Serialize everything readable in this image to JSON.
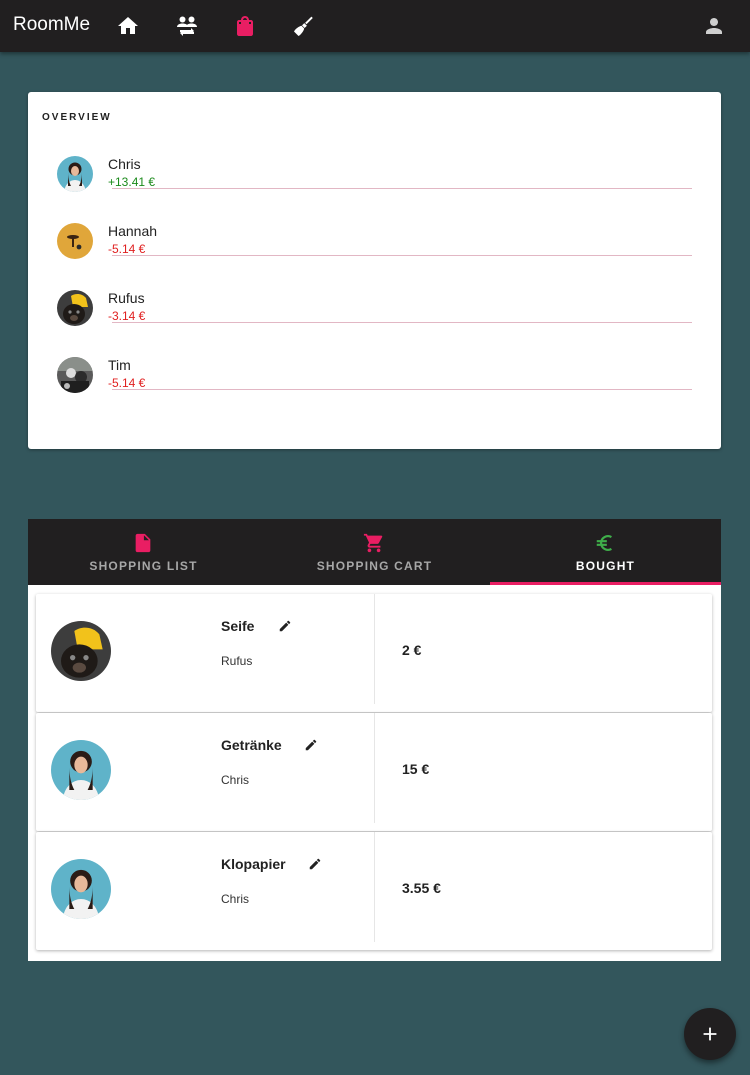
{
  "app": {
    "title": "RoomMe"
  },
  "colors": {
    "accent": "#e91e63",
    "positive": "#1b8a1b",
    "negative": "#e02020",
    "euro_green": "#3fae4a",
    "dark": "#211f20",
    "background": "#33565c"
  },
  "nav": {
    "items": [
      {
        "icon": "home-icon",
        "active": false
      },
      {
        "icon": "people-swap-icon",
        "active": false
      },
      {
        "icon": "shopping-bag-icon",
        "active": true
      },
      {
        "icon": "broom-icon",
        "active": false
      }
    ],
    "account_icon": "account-icon"
  },
  "overview": {
    "title": "OVERVIEW",
    "people": [
      {
        "name": "Chris",
        "balance": "+13.41 €",
        "positive": true
      },
      {
        "name": "Hannah",
        "balance": "-5.14 €",
        "positive": false
      },
      {
        "name": "Rufus",
        "balance": "-3.14 €",
        "positive": false
      },
      {
        "name": "Tim",
        "balance": "-5.14 €",
        "positive": false
      }
    ]
  },
  "tabs": [
    {
      "label": "SHOPPING LIST",
      "icon": "file-icon",
      "active": false
    },
    {
      "label": "SHOPPING CART",
      "icon": "cart-icon",
      "active": false
    },
    {
      "label": "BOUGHT",
      "icon": "euro-icon",
      "active": true
    }
  ],
  "items": [
    {
      "name": "Seife",
      "buyer": "Rufus",
      "price": "2 €"
    },
    {
      "name": "Getränke",
      "buyer": "Chris",
      "price": "15 €"
    },
    {
      "name": "Klopapier",
      "buyer": "Chris",
      "price": "3.55 €"
    }
  ],
  "fab": {
    "icon": "plus-icon"
  }
}
